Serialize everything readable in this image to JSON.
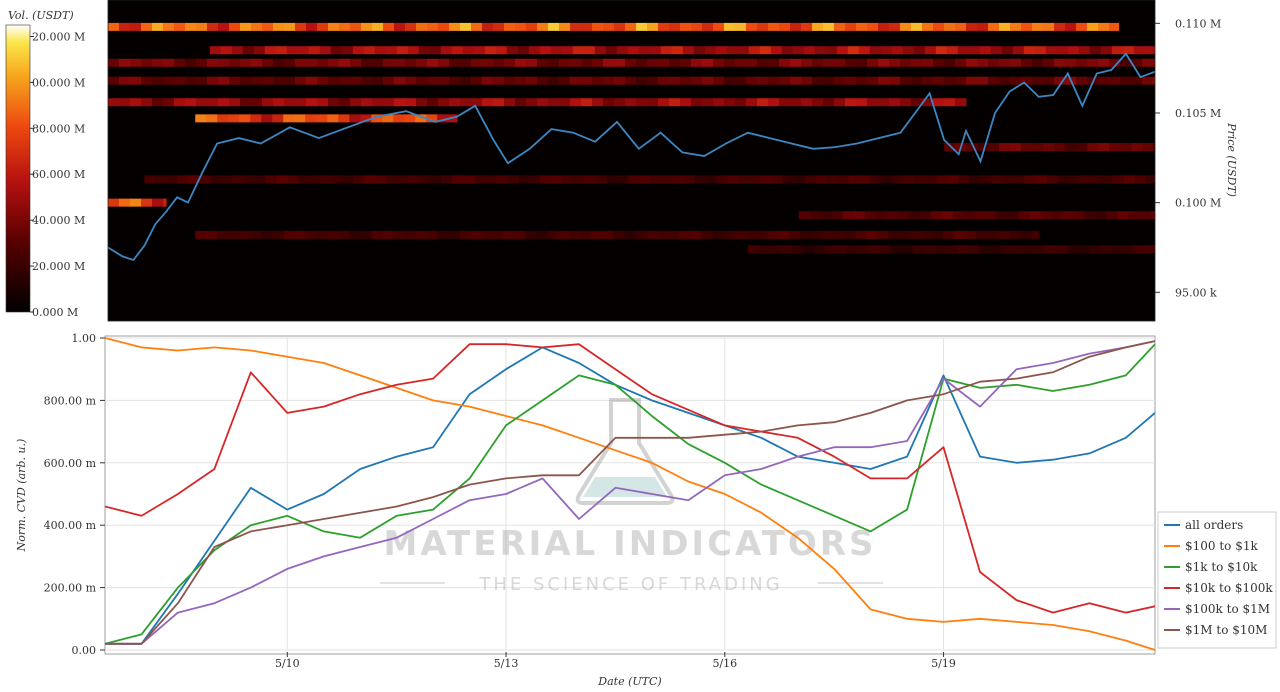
{
  "chart_data": [
    {
      "type": "heatmap",
      "colorbar": {
        "label": "Vol. (USDT)",
        "ticks": [
          "0.000 M",
          "20.000 M",
          "40.000 M",
          "60.000 M",
          "80.000 M",
          "00.000 M",
          "20.000 M"
        ],
        "values": [
          0,
          20,
          40,
          60,
          80,
          100,
          120
        ],
        "range": [
          0,
          125
        ]
      },
      "yaxis": {
        "label": "Price (USDT)",
        "ticks": [
          "95.00 k",
          "0.100 M",
          "0.105 M",
          "0.110 M"
        ],
        "values": [
          95000,
          100000,
          105000,
          110000
        ],
        "range": [
          93400,
          111300
        ]
      },
      "x_range_days": [
        7.5,
        21.9
      ],
      "price_series": {
        "name": "price",
        "color": "#3b87c4",
        "x": [
          7.5,
          7.7,
          7.85,
          8.0,
          8.15,
          8.3,
          8.45,
          8.6,
          8.8,
          9.0,
          9.3,
          9.6,
          10.0,
          10.4,
          10.8,
          11.2,
          11.6,
          12.0,
          12.3,
          12.55,
          12.8,
          13.0,
          13.3,
          13.6,
          13.9,
          14.2,
          14.5,
          14.8,
          15.1,
          15.4,
          15.7,
          16.0,
          16.3,
          16.6,
          16.9,
          17.2,
          17.5,
          17.8,
          18.1,
          18.4,
          18.6,
          18.8,
          19.0,
          19.2,
          19.3,
          19.5,
          19.7,
          19.9,
          20.1,
          20.3,
          20.5,
          20.7,
          20.9,
          21.1,
          21.3,
          21.5,
          21.7,
          21.9
        ],
        "y": [
          97500,
          97000,
          96800,
          97600,
          98800,
          99500,
          100300,
          100000,
          101700,
          103300,
          103600,
          103300,
          104200,
          103600,
          104200,
          104800,
          105100,
          104500,
          104800,
          105400,
          103500,
          102200,
          103000,
          104100,
          103900,
          103400,
          104500,
          103000,
          103900,
          102800,
          102600,
          103300,
          103900,
          103600,
          103300,
          103000,
          103100,
          103300,
          103600,
          103900,
          105000,
          106100,
          103500,
          102700,
          104000,
          102300,
          105000,
          106200,
          106700,
          105900,
          106000,
          107200,
          105400,
          107200,
          107400,
          108300,
          107000,
          107300
        ]
      },
      "bands": [
        {
          "price": 109800,
          "x": [
            7.5,
            21.4
          ],
          "intensity": 0.9
        },
        {
          "price": 108500,
          "x": [
            8.9,
            21.9
          ],
          "intensity": 0.55
        },
        {
          "price": 107800,
          "x": [
            7.5,
            21.9
          ],
          "intensity": 0.4
        },
        {
          "price": 106800,
          "x": [
            7.5,
            21.9
          ],
          "intensity": 0.35
        },
        {
          "price": 105600,
          "x": [
            7.5,
            19.3
          ],
          "intensity": 0.5
        },
        {
          "price": 104700,
          "x": [
            8.7,
            12.3
          ],
          "intensity": 0.8
        },
        {
          "price": 103100,
          "x": [
            19.0,
            21.9
          ],
          "intensity": 0.35
        },
        {
          "price": 101300,
          "x": [
            8.0,
            21.9
          ],
          "intensity": 0.25
        },
        {
          "price": 100000,
          "x": [
            7.5,
            8.3
          ],
          "intensity": 0.8
        },
        {
          "price": 99300,
          "x": [
            17.0,
            21.9
          ],
          "intensity": 0.3
        },
        {
          "price": 98200,
          "x": [
            8.7,
            20.3
          ],
          "intensity": 0.25
        },
        {
          "price": 97400,
          "x": [
            16.3,
            21.9
          ],
          "intensity": 0.2
        }
      ]
    },
    {
      "type": "line",
      "xlabel": "Date (UTC)",
      "ylabel": "Norm. CVD (arb. u.)",
      "xlim": [
        7.5,
        21.9
      ],
      "ylim": [
        0,
        1
      ],
      "xticks": [
        10,
        13,
        16,
        19
      ],
      "xtick_labels": [
        "5/10",
        "5/13",
        "5/16",
        "5/19"
      ],
      "yticks": [
        0,
        0.2,
        0.4,
        0.6,
        0.8,
        1.0
      ],
      "ytick_labels": [
        "0.00",
        "200.00 m",
        "400.00 m",
        "600.00 m",
        "800.00 m",
        "1.00"
      ],
      "legend_position": "lower-right",
      "x": [
        7.5,
        8.0,
        8.5,
        9.0,
        9.5,
        10.0,
        10.5,
        11.0,
        11.5,
        12.0,
        12.5,
        13.0,
        13.5,
        14.0,
        14.5,
        15.0,
        15.5,
        16.0,
        16.5,
        17.0,
        17.5,
        18.0,
        18.5,
        19.0,
        19.5,
        20.0,
        20.5,
        21.0,
        21.5,
        21.9
      ],
      "series": [
        {
          "name": "all orders",
          "color": "#1f77b4",
          "values": [
            0.02,
            0.02,
            0.18,
            0.35,
            0.52,
            0.45,
            0.5,
            0.58,
            0.62,
            0.65,
            0.82,
            0.9,
            0.97,
            0.92,
            0.85,
            0.8,
            0.76,
            0.72,
            0.68,
            0.62,
            0.6,
            0.58,
            0.62,
            0.88,
            0.62,
            0.6,
            0.61,
            0.63,
            0.68,
            0.76
          ]
        },
        {
          "name": "$100 to $1k",
          "color": "#ff7f0e",
          "values": [
            1.0,
            0.97,
            0.96,
            0.97,
            0.96,
            0.94,
            0.92,
            0.88,
            0.84,
            0.8,
            0.78,
            0.75,
            0.72,
            0.68,
            0.64,
            0.6,
            0.54,
            0.5,
            0.44,
            0.36,
            0.26,
            0.13,
            0.1,
            0.09,
            0.1,
            0.09,
            0.08,
            0.06,
            0.03,
            0.0
          ]
        },
        {
          "name": "$1k to $10k",
          "color": "#2ca02c",
          "values": [
            0.02,
            0.05,
            0.2,
            0.32,
            0.4,
            0.43,
            0.38,
            0.36,
            0.43,
            0.45,
            0.55,
            0.72,
            0.8,
            0.88,
            0.85,
            0.75,
            0.66,
            0.6,
            0.53,
            0.48,
            0.43,
            0.38,
            0.45,
            0.87,
            0.84,
            0.85,
            0.83,
            0.85,
            0.88,
            0.98
          ]
        },
        {
          "name": "$10k to $100k",
          "color": "#d62728",
          "values": [
            0.46,
            0.43,
            0.5,
            0.58,
            0.89,
            0.76,
            0.78,
            0.82,
            0.85,
            0.87,
            0.98,
            0.98,
            0.97,
            0.98,
            0.9,
            0.82,
            0.77,
            0.72,
            0.7,
            0.68,
            0.62,
            0.55,
            0.55,
            0.65,
            0.25,
            0.16,
            0.12,
            0.15,
            0.12,
            0.14
          ]
        },
        {
          "name": "$100k to $1M",
          "color": "#9467bd",
          "values": [
            0.02,
            0.02,
            0.12,
            0.15,
            0.2,
            0.26,
            0.3,
            0.33,
            0.36,
            0.42,
            0.48,
            0.5,
            0.55,
            0.42,
            0.52,
            0.5,
            0.48,
            0.56,
            0.58,
            0.62,
            0.65,
            0.65,
            0.67,
            0.87,
            0.78,
            0.9,
            0.92,
            0.95,
            0.97,
            0.99
          ]
        },
        {
          "name": "$1M to $10M",
          "color": "#8c564b",
          "values": [
            0.02,
            0.02,
            0.15,
            0.33,
            0.38,
            0.4,
            0.42,
            0.44,
            0.46,
            0.49,
            0.53,
            0.55,
            0.56,
            0.56,
            0.68,
            0.68,
            0.68,
            0.69,
            0.7,
            0.72,
            0.73,
            0.76,
            0.8,
            0.82,
            0.86,
            0.87,
            0.89,
            0.94,
            0.97,
            0.99
          ]
        }
      ]
    }
  ],
  "watermark": {
    "title": "MATERIAL INDICATORS",
    "subtitle": "THE SCIENCE OF TRADING"
  }
}
